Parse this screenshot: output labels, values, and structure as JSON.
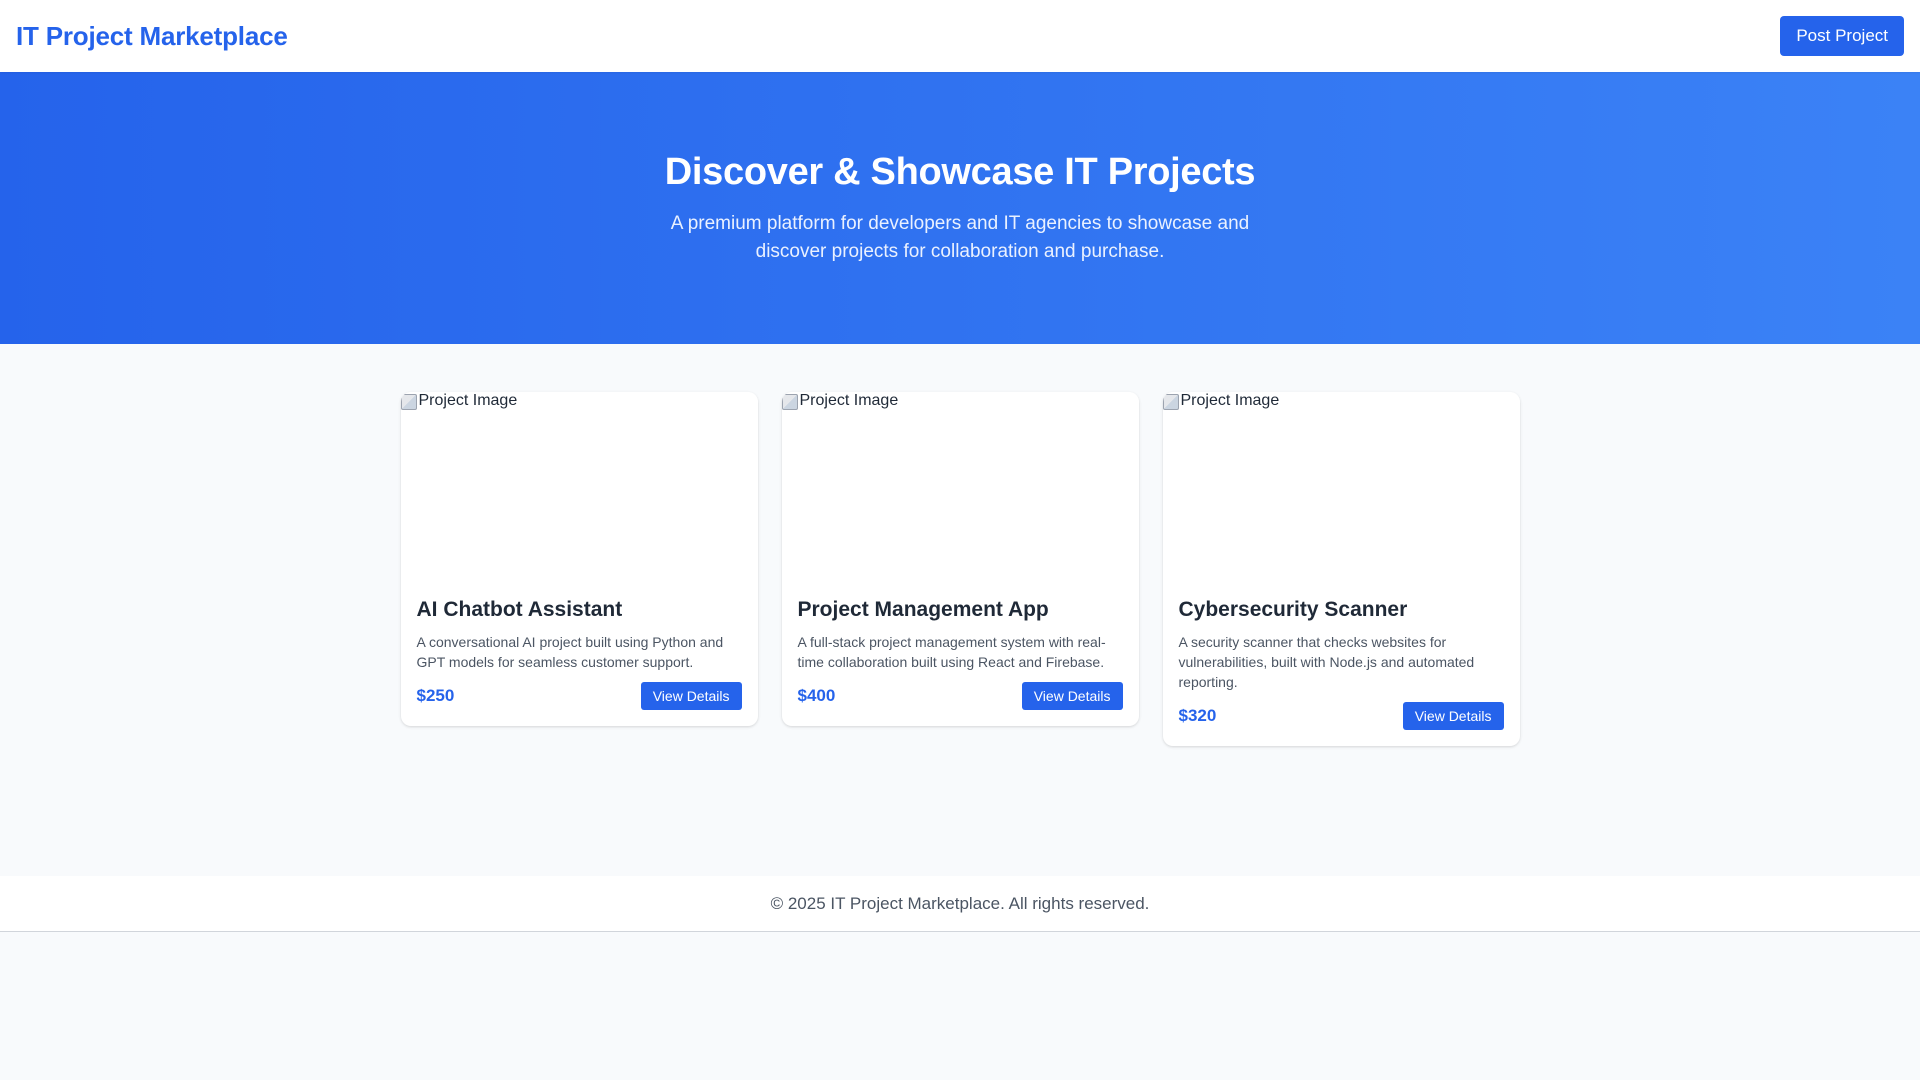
{
  "header": {
    "brand": "IT Project Marketplace",
    "post_button_label": "Post Project"
  },
  "hero": {
    "title": "Discover & Showcase IT Projects",
    "subtitle": "A premium platform for developers and IT agencies to showcase and discover projects for collaboration and purchase."
  },
  "projects": [
    {
      "image_alt": "Project Image",
      "title": "AI Chatbot Assistant",
      "description": "A conversational AI project built using Python and GPT models for seamless customer support.",
      "price": "$250",
      "button_label": "View Details"
    },
    {
      "image_alt": "Project Image",
      "title": "Project Management App",
      "description": "A full-stack project management system with real-time collaboration built using React and Firebase.",
      "price": "$400",
      "button_label": "View Details"
    },
    {
      "image_alt": "Project Image",
      "title": "Cybersecurity Scanner",
      "description": "A security scanner that checks websites for vulnerabilities, built with Node.js and automated reporting.",
      "price": "$320",
      "button_label": "View Details"
    }
  ],
  "footer": {
    "copyright": "© 2025 IT Project Marketplace. All rights reserved."
  },
  "colors": {
    "primary": "#2563eb",
    "hero_gradient_end": "#3b82f6",
    "background": "#f8fafc"
  }
}
